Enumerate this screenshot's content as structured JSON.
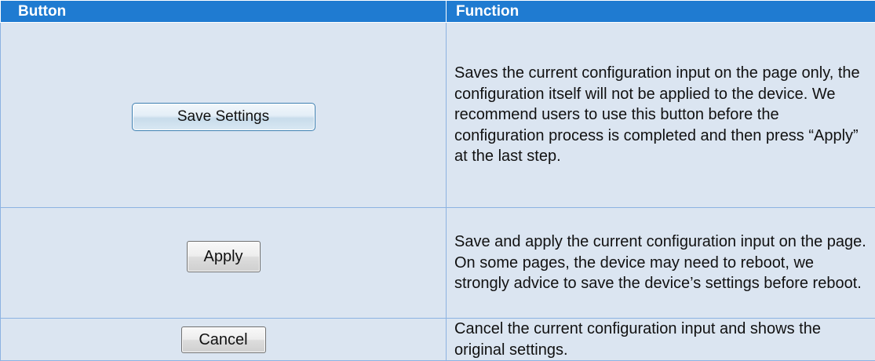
{
  "table": {
    "headers": {
      "button": "Button",
      "function": "Function"
    },
    "rows": [
      {
        "button_label": "Save Settings",
        "function_text": "Saves the current configuration input on the page only, the configuration itself will not be applied to the device. We recommend users to use this button before the configuration process is completed and then press “Apply” at the last step."
      },
      {
        "button_label": "Apply",
        "function_text": "Save and apply the current configuration input on the page. On some pages, the device may need to reboot, we strongly advice to save the device’s settings before reboot."
      },
      {
        "button_label": "Cancel",
        "function_text": "Cancel the current configuration input and shows the original settings."
      }
    ]
  },
  "colors": {
    "header_bg": "#1f7bd1",
    "row_bg": "#dbe5f1",
    "border": "#8db3e2"
  }
}
